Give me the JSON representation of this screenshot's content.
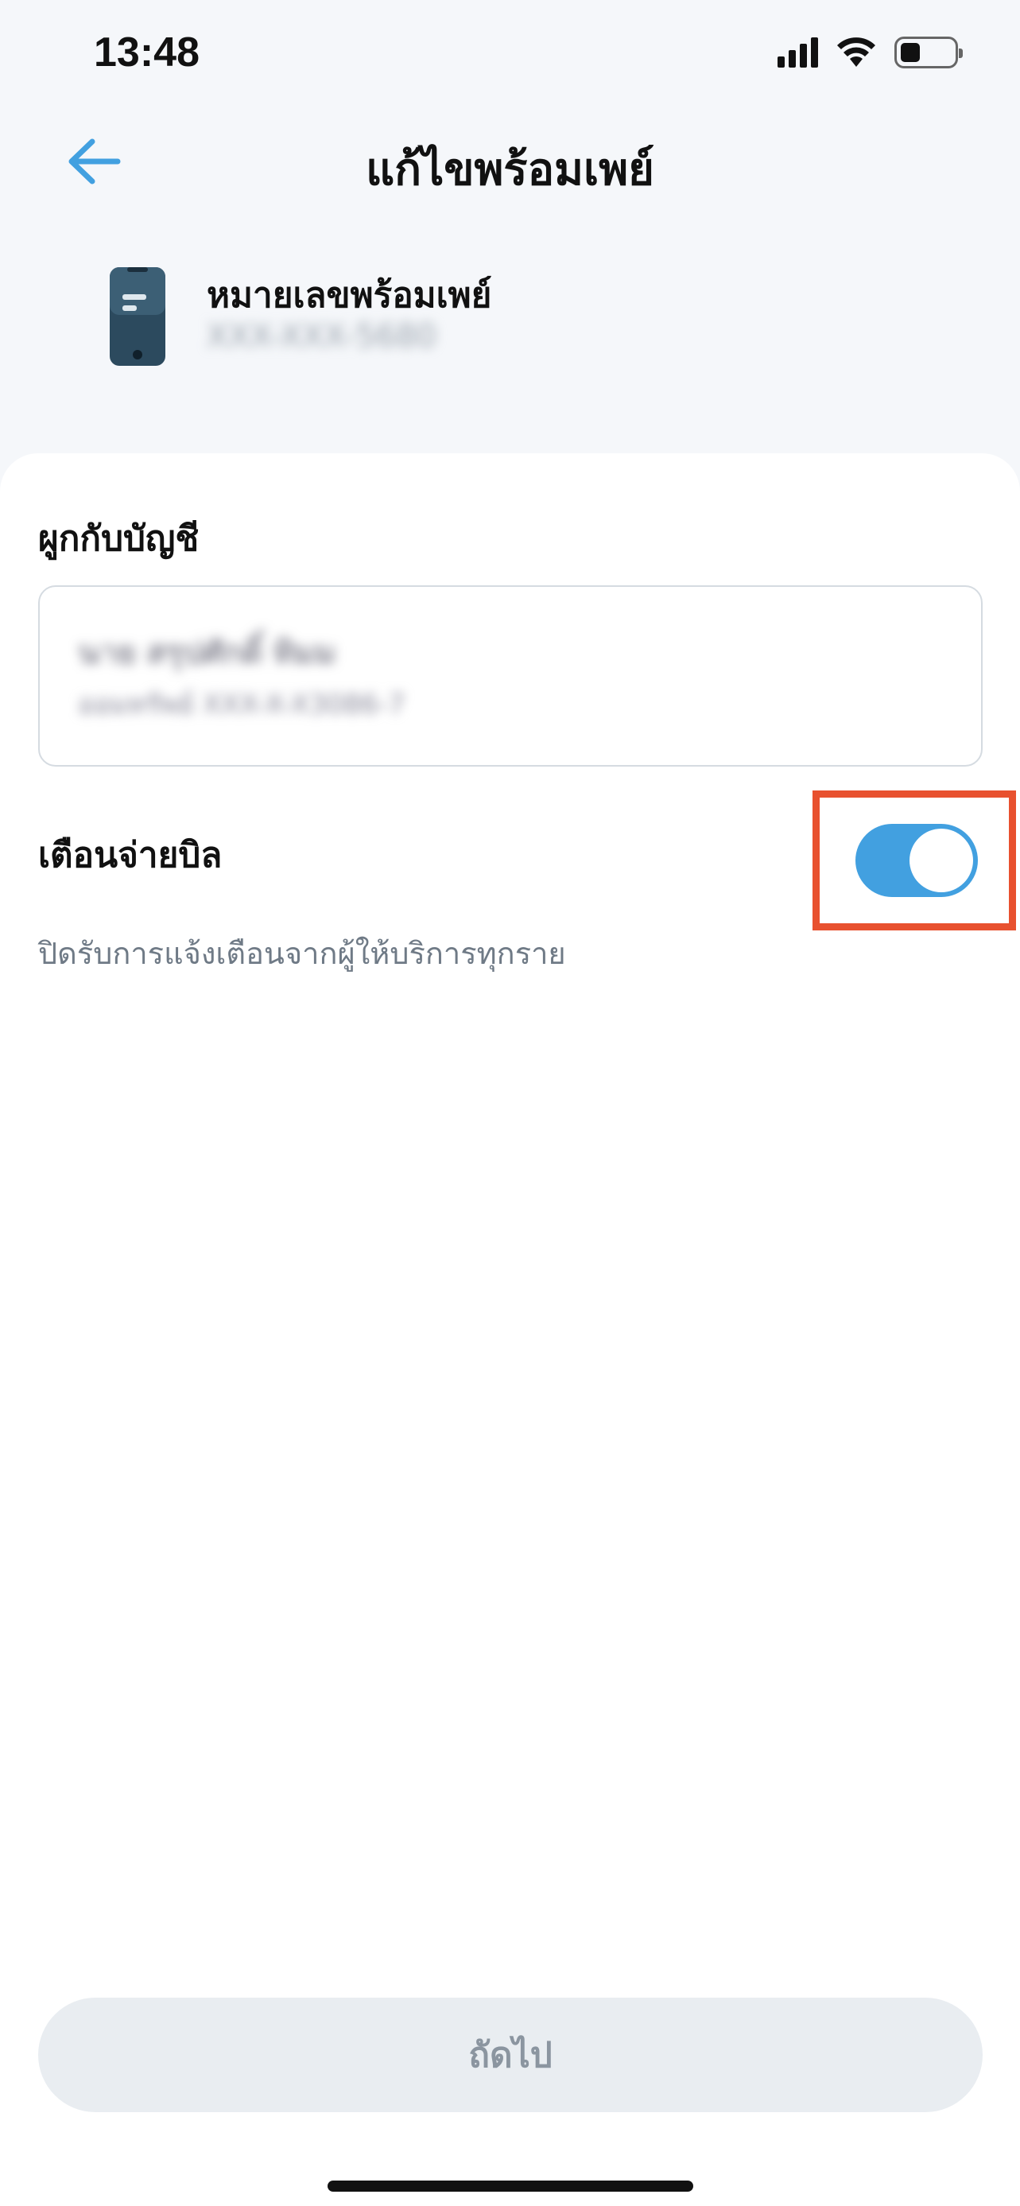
{
  "status_bar": {
    "time": "13:48",
    "icons": [
      "signal-icon",
      "wifi-icon",
      "battery-icon"
    ]
  },
  "header": {
    "title": "แก้ไขพร้อมเพย์",
    "back_icon": "arrow-left-icon"
  },
  "promptpay": {
    "label": "หมายเลขพร้อมเพย์",
    "number": "XXX-XXX-5680",
    "icon": "phone-icon"
  },
  "linked_account": {
    "label": "ผูกกับบัญชี",
    "account_name": "นาย สรุปศักดิ์ ทิมม",
    "account_number": "ออมทรัพย์ XXX-X-X3086-7"
  },
  "bill_alert": {
    "label": "เตือนจ่ายบิล",
    "description": "ปิดรับการแจ้งเตือนจากผู้ให้บริการทุกราย",
    "enabled": true
  },
  "footer": {
    "next_label": "ถัดไป"
  },
  "colors": {
    "accent": "#42a0e0",
    "highlight": "#e8512f",
    "background": "#f5f7fa",
    "button_disabled": "#e9edf1"
  }
}
